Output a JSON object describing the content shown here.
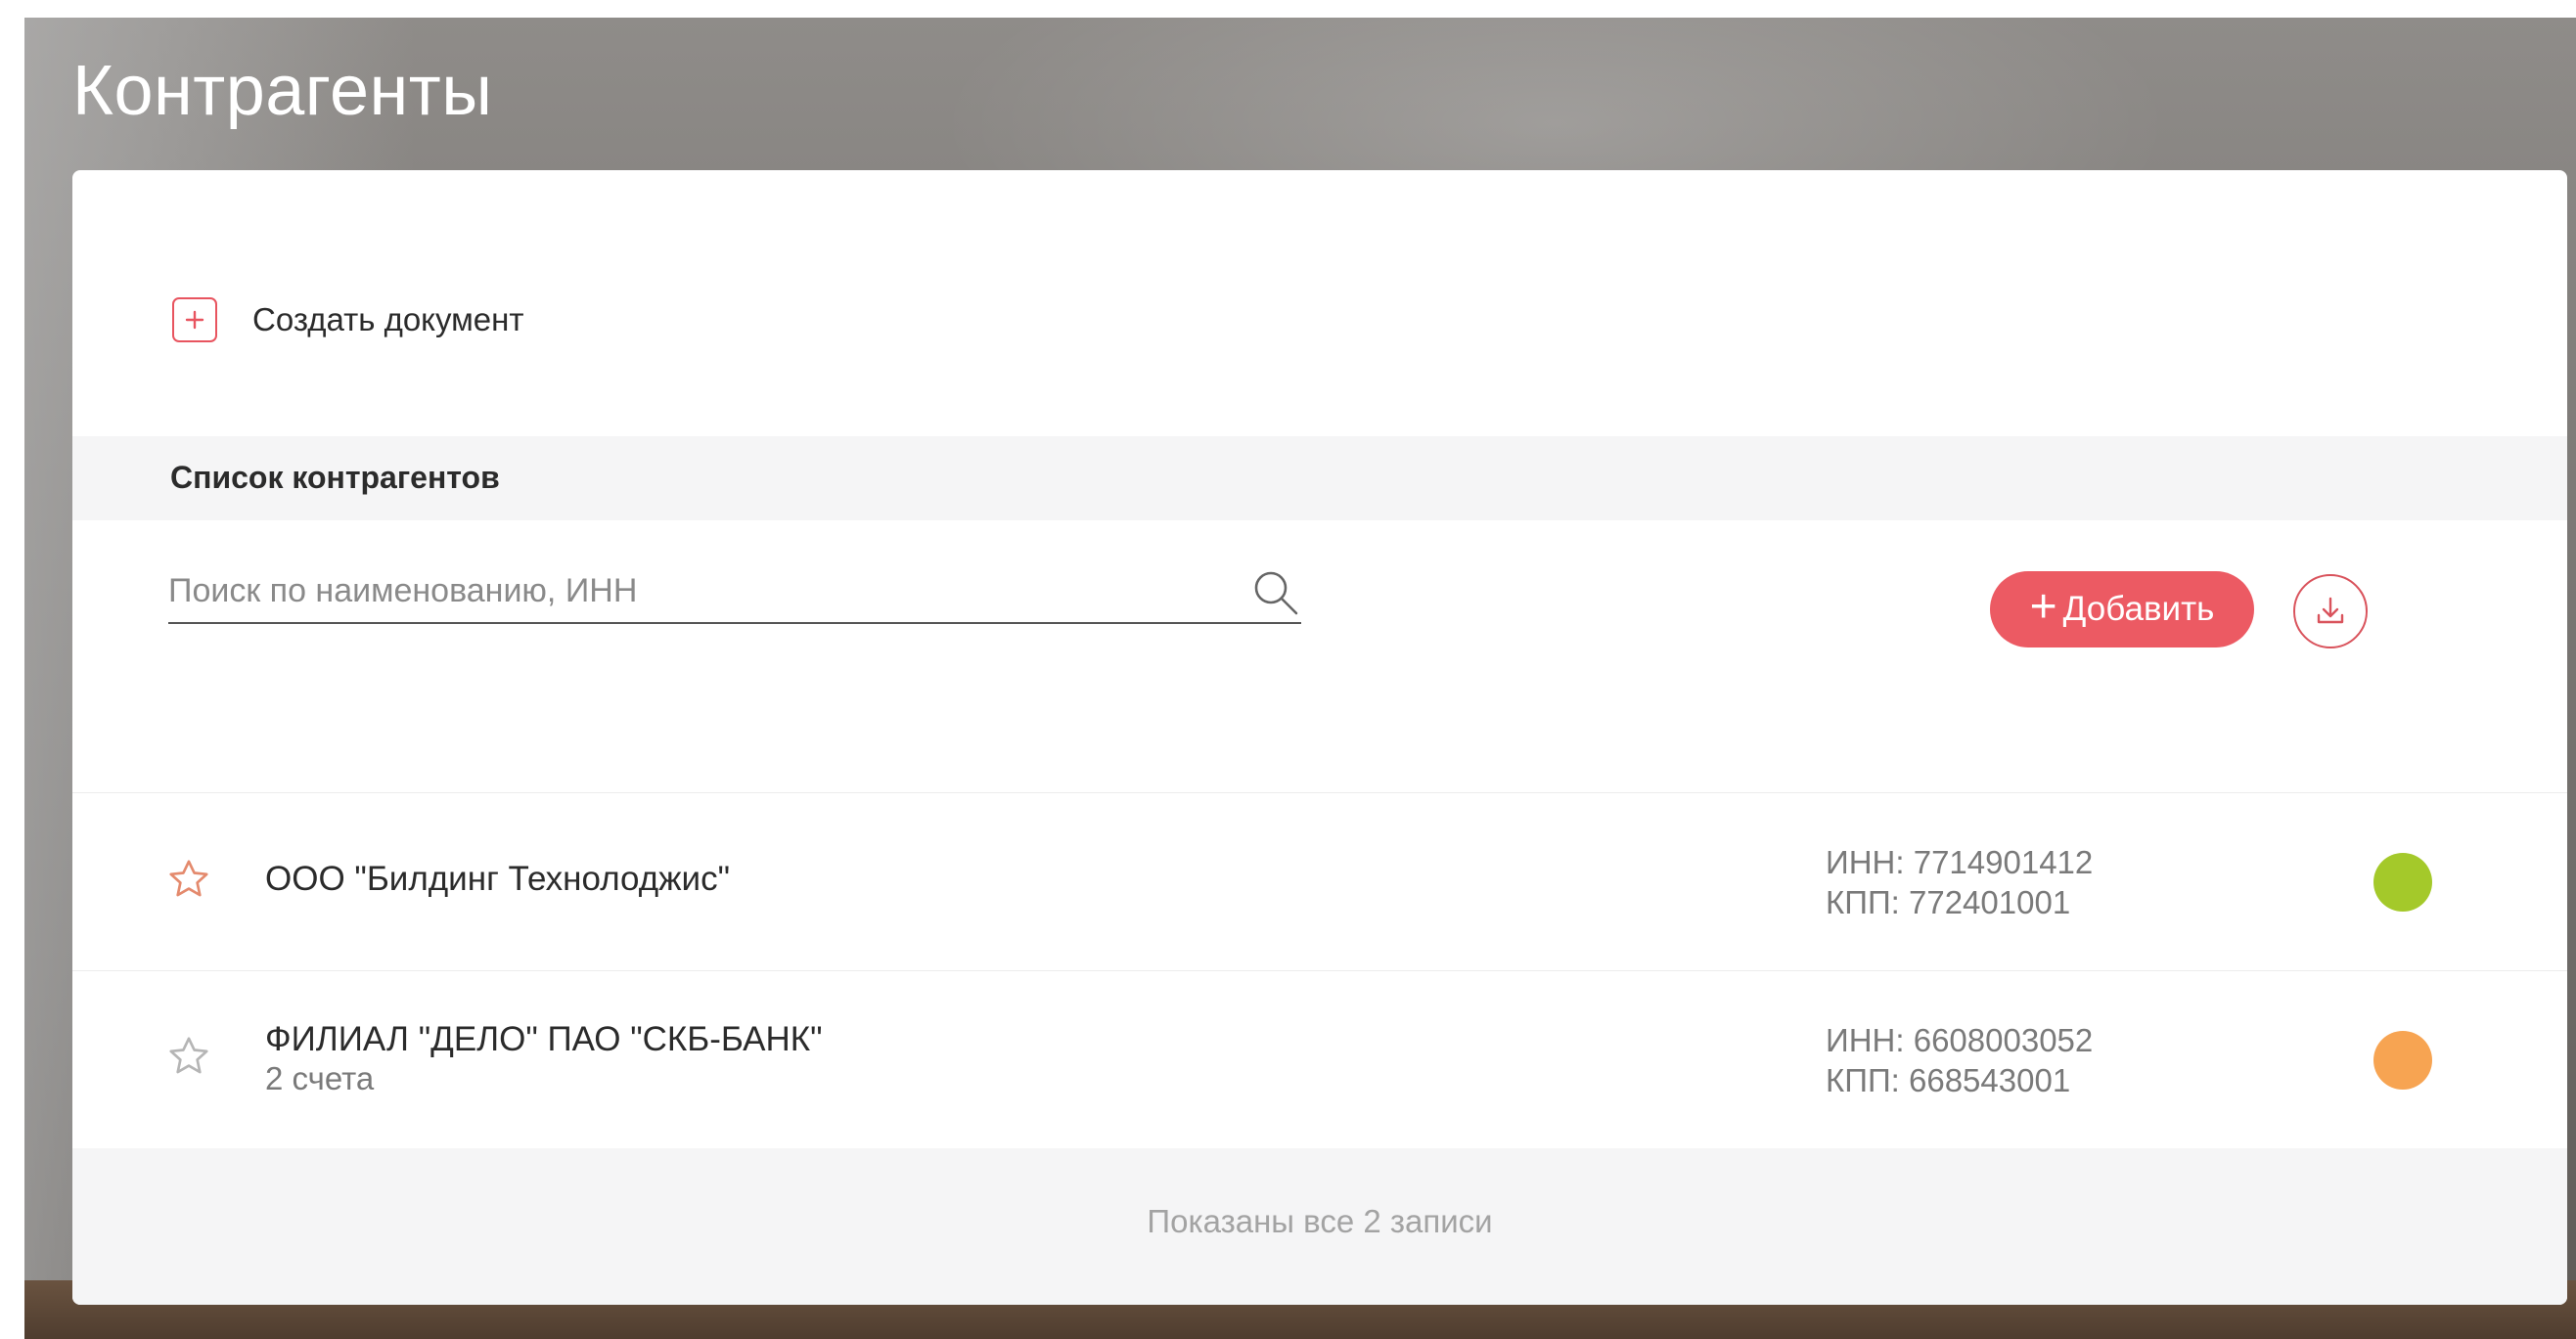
{
  "page": {
    "title": "Контрагенты"
  },
  "toolbar": {
    "create_document_label": "Создать документ"
  },
  "list": {
    "section_title": "Список контрагентов",
    "search": {
      "placeholder": "Поиск по наименованию, ИНН",
      "value": ""
    },
    "add_button_label": "Добавить",
    "add_button_icon": "plus-icon",
    "download_icon": "download-icon",
    "rows": [
      {
        "name": "ООО \"Билдинг Технолоджис\"",
        "subtitle": "",
        "inn": "ИНН: 7714901412",
        "kpp": "КПП: 772401001",
        "favorite_icon": "star-outline-icon",
        "status_color": "#a4c92a"
      },
      {
        "name": "ФИЛИАЛ \"ДЕЛО\" ПАО \"СКБ-БАНК\"",
        "subtitle": "2 счета",
        "inn": "ИНН: 6608003052",
        "kpp": "КПП: 668543001",
        "favorite_icon": "star-outline-icon",
        "status_color": "#f7a452"
      }
    ],
    "footer_text": "Показаны все 2 записи"
  },
  "colors": {
    "accent": "#ec5a63",
    "star": "#e48a6d",
    "star_muted": "#b5b5b5"
  }
}
